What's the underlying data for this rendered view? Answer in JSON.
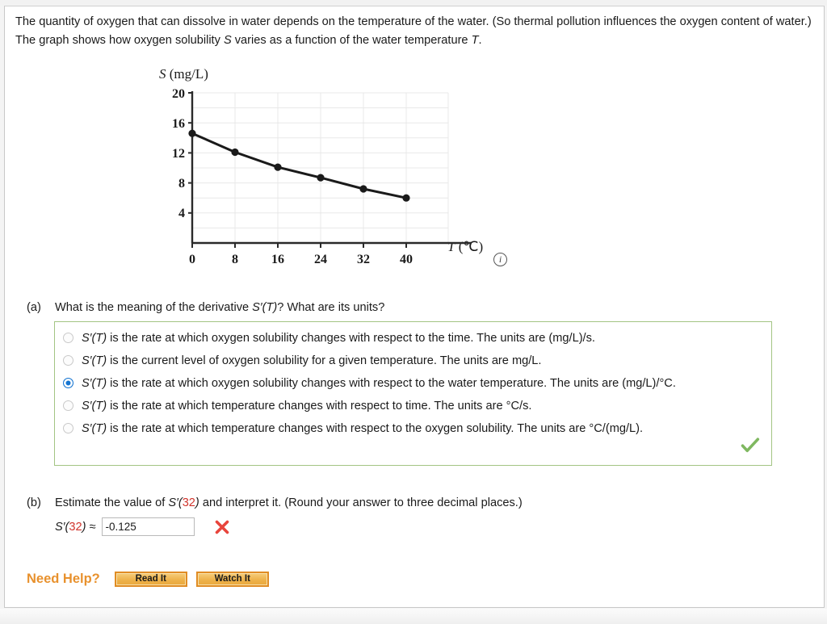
{
  "statement": {
    "line1_a": "The quantity of oxygen that can dissolve in water depends on the temperature of the water. (So thermal pollution influences the oxygen",
    "line2_a": "content of water.) The graph shows how oxygen solubility ",
    "line2_var1": "S",
    "line2_b": " varies as a function of the water temperature ",
    "line2_var2": "T",
    "line2_c": "."
  },
  "chart_data": {
    "type": "line",
    "title": "",
    "xlabel": "T (℃)",
    "ylabel": "S (mg/L)",
    "ylabel_var": "S",
    "ylabel_unit": "(mg/L)",
    "xlabel_var": "T",
    "xlabel_unit": "(℃)",
    "x": [
      0,
      8,
      16,
      24,
      32,
      40
    ],
    "values": [
      14.6,
      12.1,
      10.1,
      8.7,
      7.2,
      6.0
    ],
    "series": [
      {
        "name": "oxygen solubility",
        "values": [
          14.6,
          12.1,
          10.1,
          8.7,
          7.2,
          6.0
        ]
      }
    ],
    "xticks": [
      "0",
      "8",
      "16",
      "24",
      "32",
      "40"
    ],
    "yticks": [
      "4",
      "8",
      "12",
      "16",
      "20"
    ],
    "xlim": [
      0,
      48
    ],
    "ylim": [
      0,
      20
    ],
    "grid": true,
    "grid_minor_step": 2,
    "legend": "none",
    "marker": "filled-circle",
    "line_color": "#1a1a1a",
    "grid_color": "#e6e6e6",
    "info_icon": "i"
  },
  "part_a": {
    "label": "(a)",
    "question_pre": "What is the meaning of the derivative ",
    "question_var": "S′(T)",
    "question_post": "? What are its units?",
    "selected_index": 2,
    "choices": [
      {
        "var": "S′(T)",
        "text": " is the rate at which oxygen solubility changes with respect to the time. The units are (mg/L)/s.",
        "selected": false
      },
      {
        "var": "S′(T)",
        "text": " is the current level of oxygen solubility for a given temperature. The units are mg/L.",
        "selected": false
      },
      {
        "var": "S′(T)",
        "text": " is the rate at which oxygen solubility changes with respect to the water temperature. The units are (mg/L)/°C.",
        "selected": true
      },
      {
        "var": "S′(T)",
        "text": " is the rate at which temperature changes with respect to time. The units are °C/s.",
        "selected": false
      },
      {
        "var": "S′(T)",
        "text": " is the rate at which temperature changes with respect to the oxygen solubility. The units are °C/(mg/L).",
        "selected": false
      }
    ],
    "status": "correct",
    "status_icon": "check-mark"
  },
  "part_b": {
    "label": "(b)",
    "question_pre": "Estimate the value of ",
    "question_var": "S′(",
    "question_num": "32",
    "question_mid": ")",
    "question_post": " and interpret it. (Round your answer to three decimal places.)",
    "answer_lead_var": "S′(",
    "answer_lead_num": "32",
    "answer_lead_post": ") ≈",
    "answer_value": "-0.125",
    "status": "incorrect",
    "status_icon": "x-mark"
  },
  "need_help": {
    "label": "Need Help?",
    "buttons": [
      {
        "label": "Read It"
      },
      {
        "label": "Watch It"
      }
    ]
  },
  "colors": {
    "accent_orange": "#e8912d",
    "correct_green": "#7fb860",
    "incorrect_red": "#e8453c",
    "radio_blue": "#1675d1",
    "box_border_green": "#a3c483",
    "red_number": "#d0342c"
  }
}
